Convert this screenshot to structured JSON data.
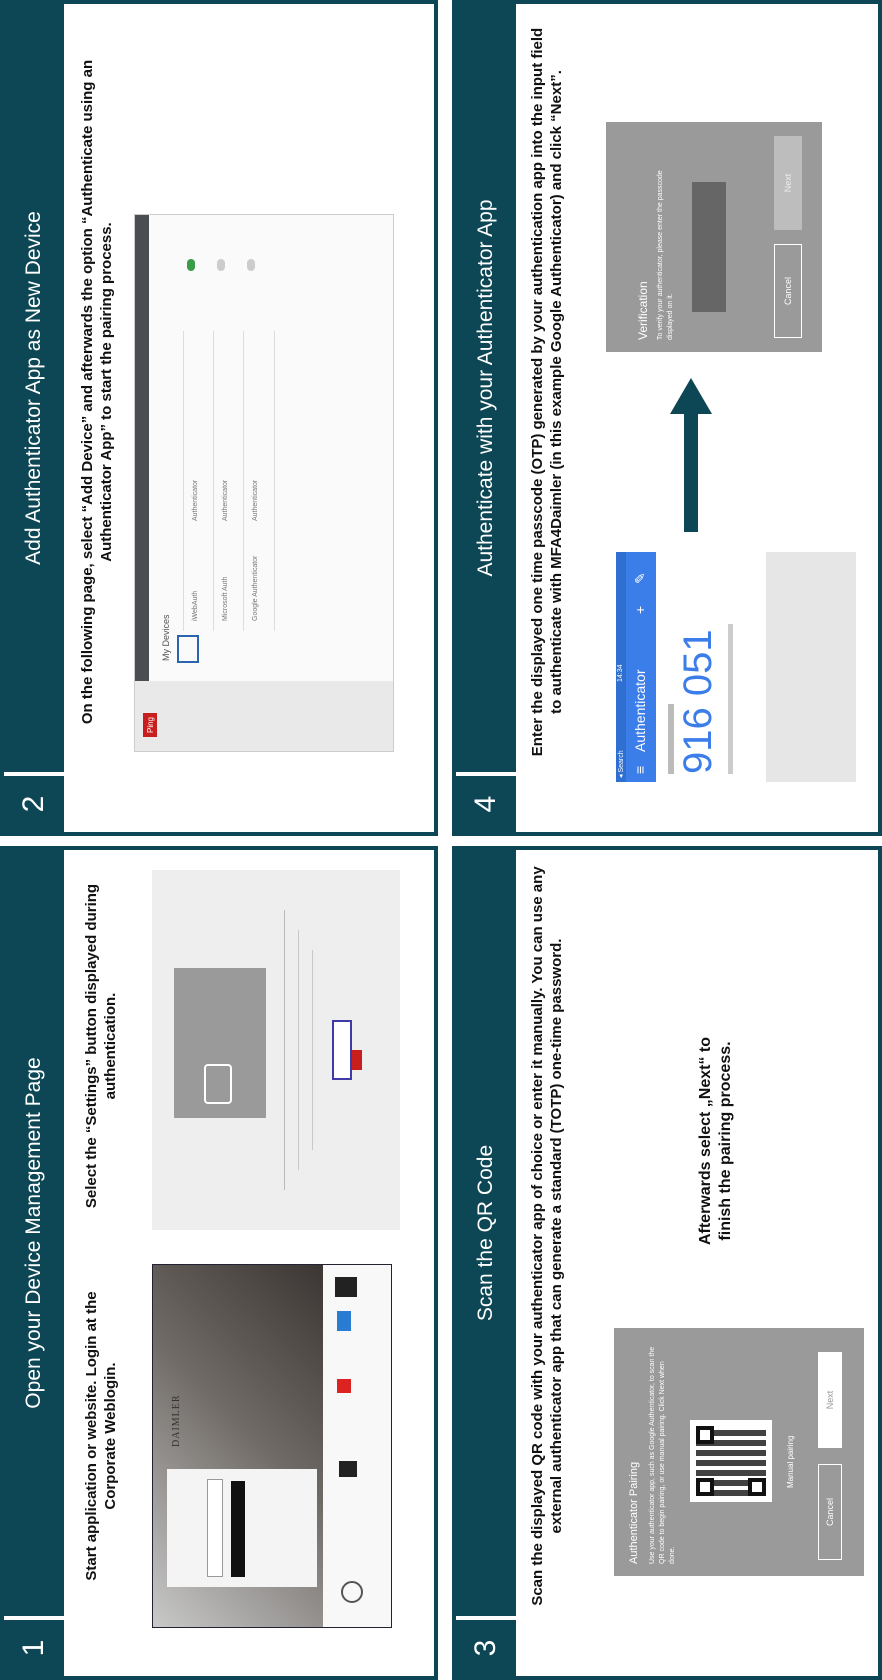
{
  "steps": [
    {
      "number": "1",
      "title": "Open your Device Management Page"
    },
    {
      "number": "2",
      "title": "Add Authenticator App as New Device"
    },
    {
      "number": "3",
      "title": "Scan the QR Code"
    },
    {
      "number": "4",
      "title": "Authenticate with your Authenticator App"
    }
  ],
  "step1": {
    "text_left": "Start application or website. Login at the Corporate Weblogin.",
    "text_right": "Select the “Settings” button displayed during authentication.",
    "brand": "DAIMLER"
  },
  "step2": {
    "text": "On the following page, select “Add Device” and afterwards the option “Authenticate using an Authenticator App” to start the pairing process.",
    "logo": "Ping",
    "heading": "My Devices",
    "devices": [
      "iWebAuth",
      "Microsoft Auth",
      "Google Authenticator"
    ],
    "type": "Authenticator"
  },
  "step3": {
    "text": "Scan the displayed QR code with your authenticator app of choice or enter it manually. You can use any external authenticator app that can generate a standard (TOTP) one-time password.",
    "text_after": "Afterwards select „Next“ to finish the pairing process.",
    "dialog_title": "Authenticator Pairing",
    "dialog_body": "Use your authenticator app, such as Google Authenticator, to scan the QR code to begin pairing, or use manual pairing. Click Next when done.",
    "manual": "Manual pairing",
    "cancel": "Cancel",
    "next": "Next"
  },
  "step4": {
    "text": "Enter the displayed one time passcode (OTP) generated by your authentication app into the input field to authenticate with MFA4Daimler (in this example Google Authenticator) and click “Next”.",
    "app_title": "Authenticator",
    "time": "14:34",
    "carrier": "◂ Search",
    "code": "916 051",
    "verify_title": "Verification",
    "verify_body": "To verify your authenticator, please enter the passcode displayed on it.",
    "cancel": "Cancel",
    "next": "Next"
  },
  "colors": {
    "header": "#0d4654",
    "dialog": "#9a9a9a",
    "google_blue": "#3b7de9"
  }
}
